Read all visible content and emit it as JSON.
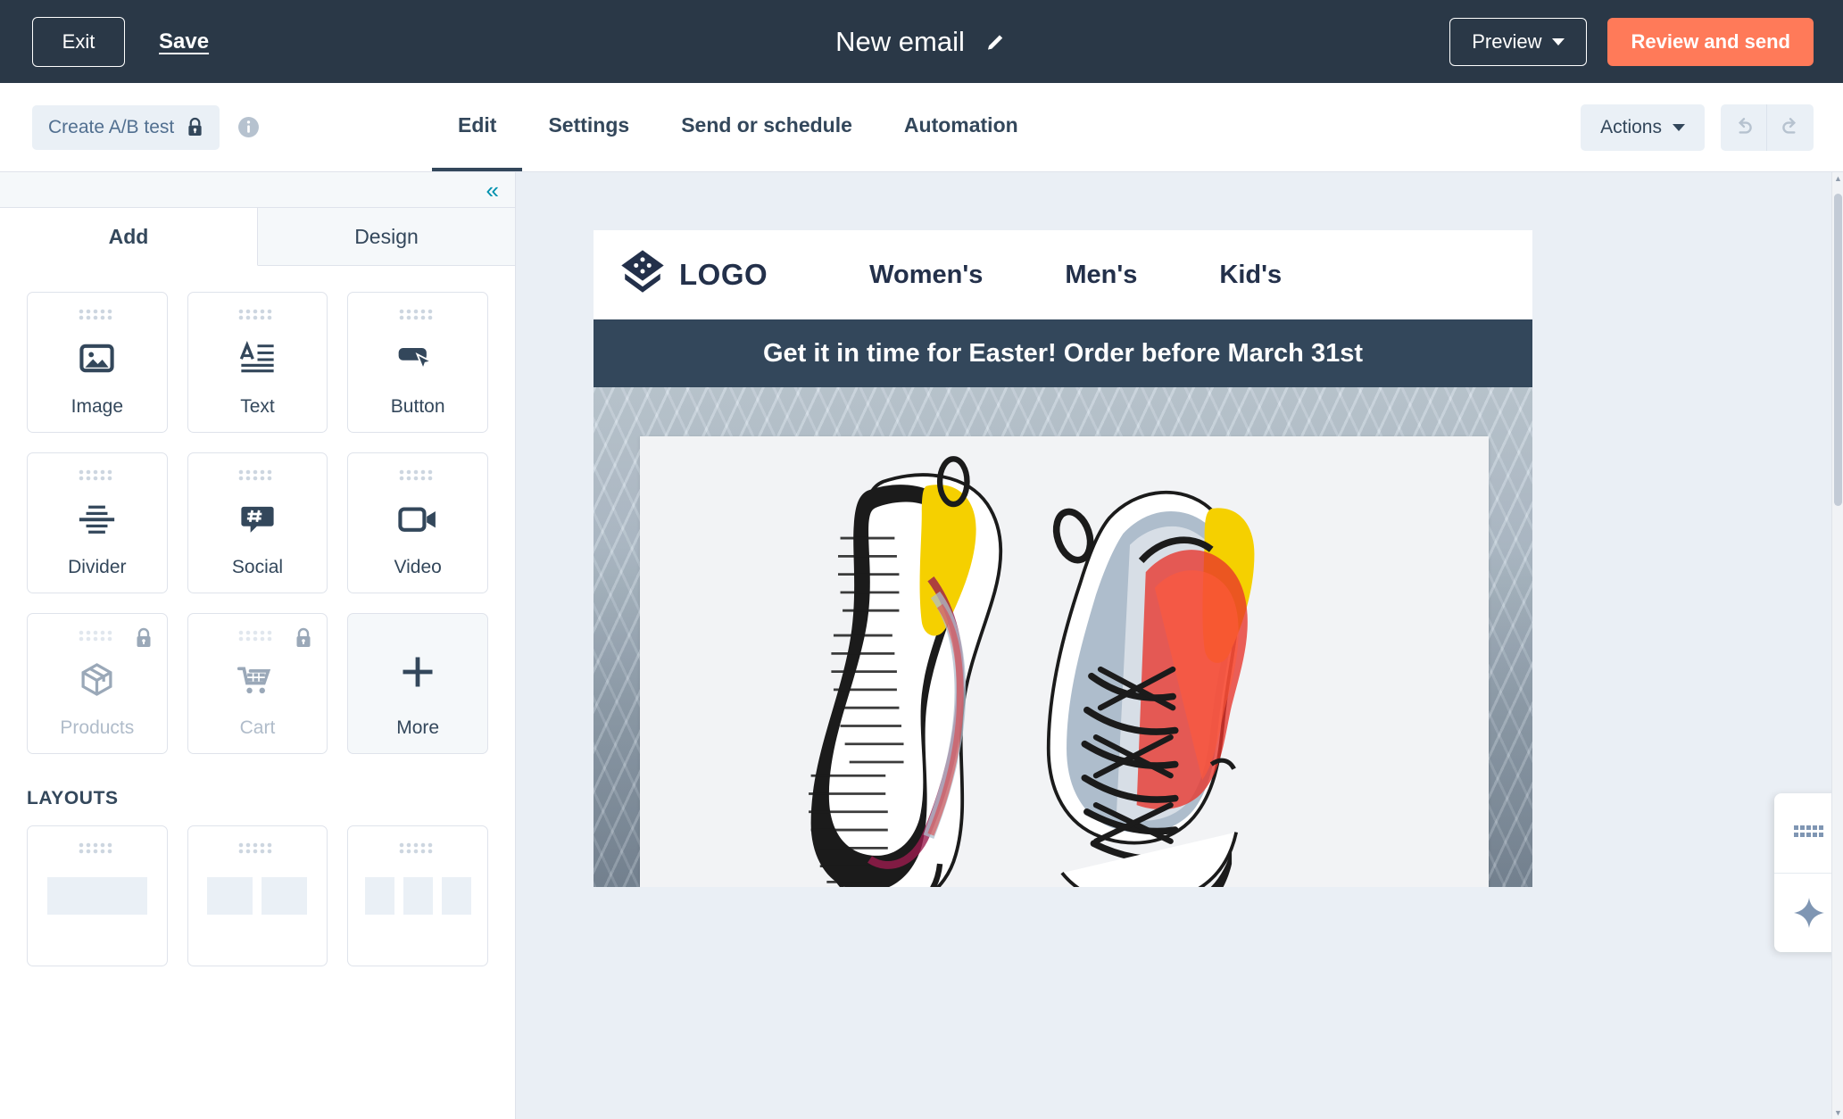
{
  "topbar": {
    "exit_label": "Exit",
    "save_label": "Save",
    "email_title": "New email",
    "edit_title_icon": "pencil-icon",
    "preview_label": "Preview",
    "review_send_label": "Review and send",
    "accent_color": "#ff7a59",
    "background_color": "#2a3847"
  },
  "navbar": {
    "ab_test_label": "Create A/B test",
    "ab_test_locked": true,
    "info_icon": "info-icon",
    "tabs": [
      {
        "label": "Edit",
        "active": true
      },
      {
        "label": "Settings",
        "active": false
      },
      {
        "label": "Send or schedule",
        "active": false
      },
      {
        "label": "Automation",
        "active": false
      }
    ],
    "actions_label": "Actions",
    "undo_icon": "undo-icon",
    "redo_icon": "redo-icon"
  },
  "left_panel": {
    "collapse_icon": "double-chevron-left-icon",
    "tabs": [
      {
        "label": "Add",
        "active": true
      },
      {
        "label": "Design",
        "active": false
      }
    ],
    "blocks": [
      {
        "label": "Image",
        "icon": "image-icon",
        "locked": false,
        "muted": false
      },
      {
        "label": "Text",
        "icon": "text-icon",
        "locked": false,
        "muted": false
      },
      {
        "label": "Button",
        "icon": "button-icon",
        "locked": false,
        "muted": false
      },
      {
        "label": "Divider",
        "icon": "divider-icon",
        "locked": false,
        "muted": false
      },
      {
        "label": "Social",
        "icon": "social-icon",
        "locked": false,
        "muted": false
      },
      {
        "label": "Video",
        "icon": "video-icon",
        "locked": false,
        "muted": false
      },
      {
        "label": "Products",
        "icon": "box-icon",
        "locked": true,
        "muted": true
      },
      {
        "label": "Cart",
        "icon": "cart-icon",
        "locked": true,
        "muted": true
      },
      {
        "label": "More",
        "icon": "plus-icon",
        "locked": false,
        "muted": false
      }
    ],
    "layouts_heading": "LAYOUTS",
    "layouts": [
      {
        "columns": 1
      },
      {
        "columns": 2
      },
      {
        "columns": 3
      }
    ]
  },
  "email_preview": {
    "logo_text": "LOGO",
    "logo_icon": "diamond-layers-logo-icon",
    "nav": [
      "Women's",
      "Men's",
      "Kid's"
    ],
    "banner_text": "Get it in time for Easter! Order before March 31st",
    "banner_color": "#33475b",
    "hero_alt": "running-shoes-photo"
  },
  "float_panel": {
    "grid_icon": "grid-dots-icon",
    "ai_icon": "ai-sparkle-icon"
  }
}
